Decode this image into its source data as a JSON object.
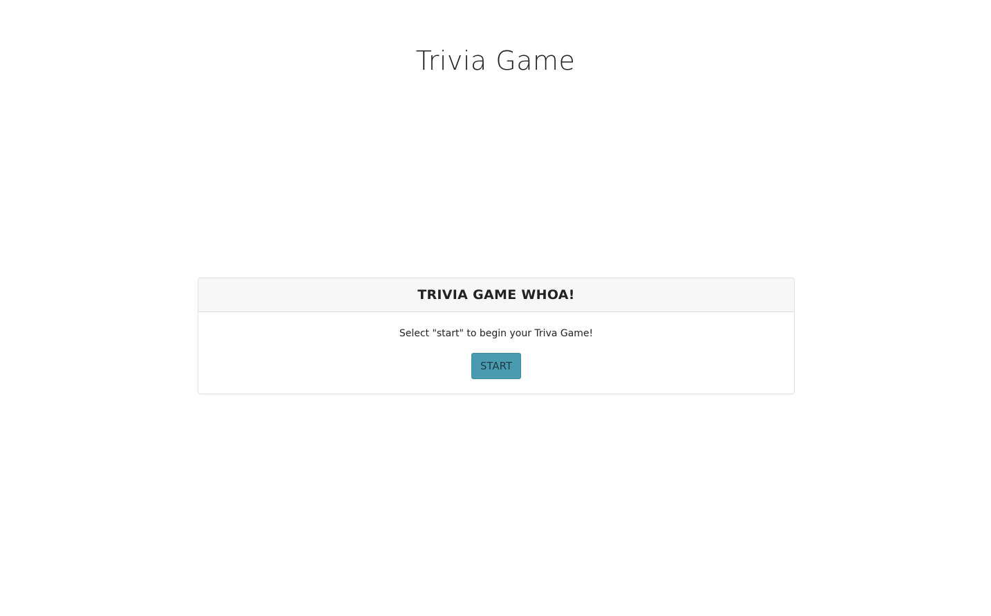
{
  "page": {
    "title": "Trivia Game"
  },
  "card": {
    "header": "TRIVIA GAME WHOA!",
    "instruction": "Select \"start\" to begin your Triva Game!",
    "start_label": "START"
  },
  "colors": {
    "button_bg": "#4a9bb0",
    "header_bg": "#f7f7f7",
    "border": "#dfdfdf"
  }
}
